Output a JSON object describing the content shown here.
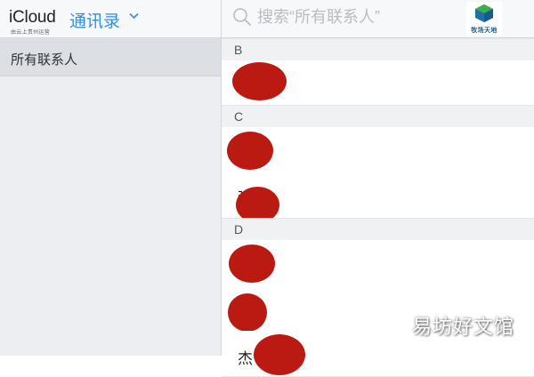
{
  "header": {
    "brand": "iCloud",
    "app_title": "通讯录",
    "subtitle": "由云上贵州运营"
  },
  "sidebar": {
    "groups": [
      {
        "label": "所有联系人",
        "selected": true
      }
    ]
  },
  "search": {
    "placeholder": "搜索“所有联系人”"
  },
  "corner_logo": {
    "text": "牧场天地"
  },
  "contacts": {
    "sections": [
      {
        "letter": "B",
        "rows": [
          {
            "name": ""
          }
        ]
      },
      {
        "letter": "C",
        "rows": [
          {
            "name": ""
          },
          {
            "name": "粥"
          }
        ]
      },
      {
        "letter": "D",
        "rows": [
          {
            "name": ""
          },
          {
            "name": ""
          },
          {
            "name": "杰"
          }
        ]
      }
    ]
  },
  "watermark": "易坊好文馆",
  "colors": {
    "accent": "#2e8fe3",
    "redaction": "#bb1a12",
    "sidebar_bg": "#eceef1",
    "selected_bg": "#dcdfe3"
  }
}
